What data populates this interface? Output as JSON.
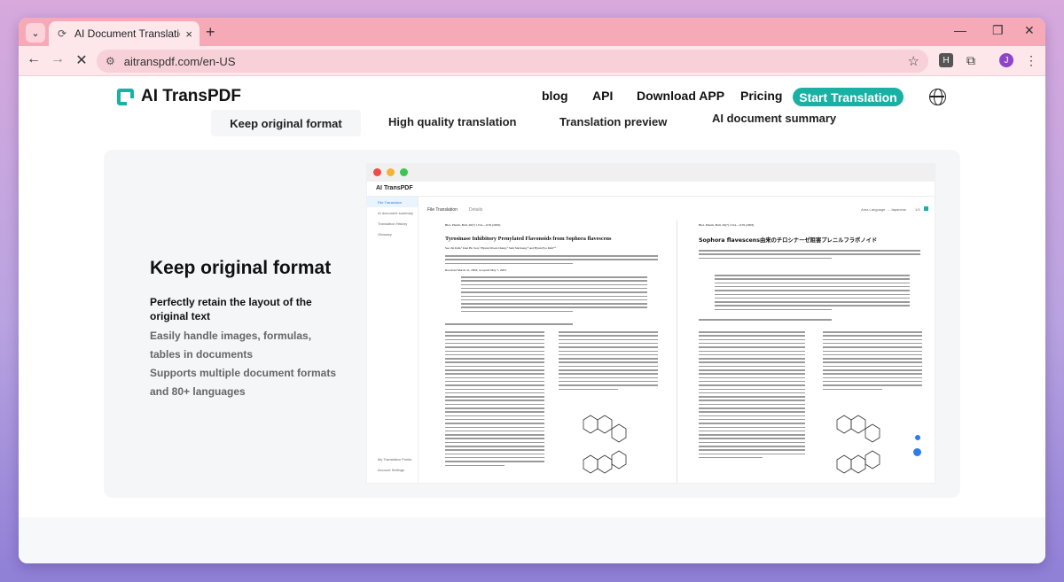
{
  "browser": {
    "tab_title": "AI Document Translation | supp",
    "tab_close": "×",
    "new_tab": "+",
    "url": "aitranspdf.com/en-US",
    "profile_initial": "J",
    "ext_initial": "H"
  },
  "header": {
    "brand": "AI TransPDF",
    "nav": [
      "blog",
      "API",
      "Download APP",
      "Pricing"
    ],
    "cta": "Start Translation"
  },
  "feature_tabs": [
    "Keep original format",
    "High quality translation",
    "Translation preview",
    "AI document summary"
  ],
  "feature": {
    "title": "Keep original format",
    "subtitle": "Perfectly retain the layout of the original text",
    "points": [
      "Easily handle images, formulas, tables in documents",
      "Supports multiple document formats and 80+ languages"
    ]
  },
  "app_shot": {
    "app_name": "AI TransPDF",
    "sidebar": [
      "File Translation",
      "AI document summary",
      "Translation History",
      "Glossary"
    ],
    "sidebar_bottom": [
      "My Translation Points",
      "Account Settings"
    ],
    "breadcrumb": "File Translation",
    "details": "Details",
    "lang_label": "Area Language → Japanese",
    "pages": "1/3",
    "left_doc": {
      "header": "Biol. Pharm. Bull. 26(7) 1154—1159 (2003)",
      "title": "Tyrosinase Inhibitory Prenylated Flavonoids from Sophora flavescens",
      "authors": "Seo Jin Kim,¹ Kun Ho Son,² Hyeun Wook Chang,³ Sam Sik Kang,⁴ and Hyun Pyo Kim*¹",
      "received": "Received March 31, 2003; accepted May 7, 2003"
    },
    "right_doc": {
      "header": "Biol. Pharm. Bull. 26(7) 1154—1159 (2003)",
      "title": "Sophora flavescens由来のチロシナーゼ阻害プレニルフラボノイド"
    }
  },
  "colors": {
    "accent": "#18b1a3",
    "tab_strip": "#f6aab8",
    "toolbar": "#fde7eb"
  }
}
